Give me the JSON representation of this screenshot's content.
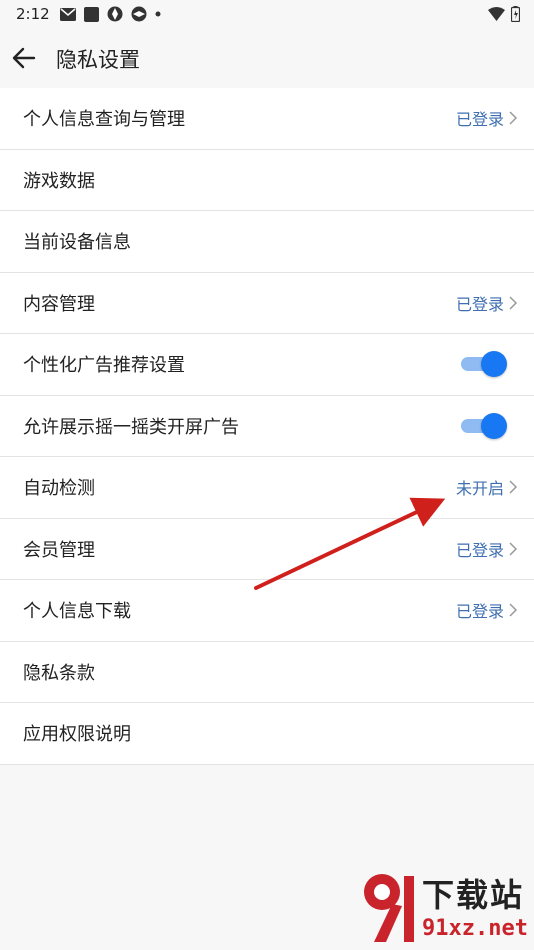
{
  "status_bar": {
    "time": "2:12"
  },
  "app_bar": {
    "title": "隐私设置"
  },
  "rows": [
    {
      "label": "个人信息查询与管理",
      "value": "已登录"
    },
    {
      "label": "游戏数据"
    },
    {
      "label": "当前设备信息"
    },
    {
      "label": "内容管理",
      "value": "已登录"
    },
    {
      "label": "个性化广告推荐设置",
      "toggle": true
    },
    {
      "label": "允许展示摇一摇类开屏广告",
      "toggle": true
    },
    {
      "label": "自动检测",
      "value": "未开启"
    },
    {
      "label": "会员管理",
      "value": "已登录"
    },
    {
      "label": "个人信息下载",
      "value": "已登录"
    },
    {
      "label": "隐私条款"
    },
    {
      "label": "应用权限说明"
    }
  ],
  "watermark": {
    "text": "下载站",
    "domain": "91xz.net"
  },
  "colors": {
    "accent": "#1877f2",
    "value_text": "#3f6fb0",
    "arrow": "#d0201c"
  }
}
